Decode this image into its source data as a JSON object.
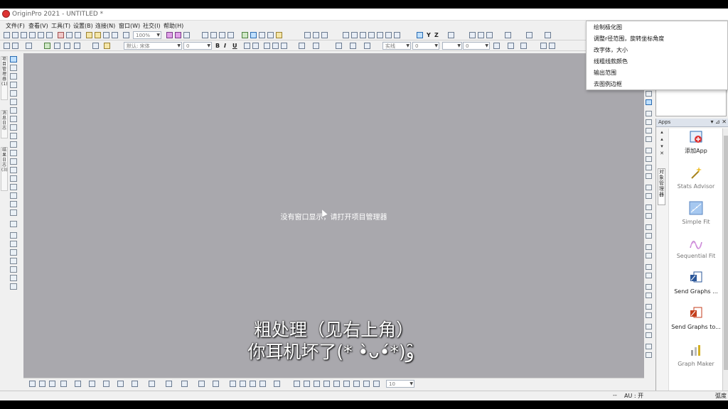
{
  "window": {
    "title": "OriginPro 2021 - UNTITLED *"
  },
  "menubar": {
    "items": [
      "文件(F)",
      "查看(V)",
      "工具(T)",
      "设置(B)",
      "连接(N)",
      "窗口(W)",
      "社交(I)",
      "帮助(H)"
    ]
  },
  "toolbar": {
    "zoom_value": "100%",
    "font_value": "默认: 宋体",
    "font_size_value": "0",
    "bold_label": "B",
    "italic_label": "I",
    "underline_label": "U",
    "line_style_label": "实线",
    "num_a": "0",
    "num_b": "0",
    "label_z": "Z",
    "label_y": "Y"
  },
  "left_toolbar": {
    "tabs": [
      "项目管理器 (1)",
      "消息日志",
      "结果日志 (3)"
    ]
  },
  "workspace": {
    "message": "没有窗口显示，请打开项目管理器"
  },
  "subtitles": {
    "line1": "粗处理（见右上角）",
    "line2": "你耳机坏了(* •̀ᴗ•́*)و ̑̑"
  },
  "bottom_toolbar": {
    "size_value": "10"
  },
  "statusbar": {
    "separator": "--",
    "au": "AU : 开",
    "angle": "弧度"
  },
  "context_menu": {
    "items": [
      "绘制极化图",
      "调整r径范围，旋转坐标角度",
      "改字体，大小",
      "线粗线款颜色",
      "输出范围",
      "去图例边框"
    ]
  },
  "apps_panel": {
    "title": "Apps",
    "side_tab": "对象管理器",
    "items": [
      {
        "name": "添加App",
        "icon": "add-app-icon"
      },
      {
        "name": "Stats Advisor",
        "icon": "wand-icon"
      },
      {
        "name": "Simple Fit",
        "icon": "simple-fit-icon"
      },
      {
        "name": "Sequential Fit",
        "icon": "sequential-fit-icon"
      },
      {
        "name": "Send Graphs ...",
        "icon": "word-icon"
      },
      {
        "name": "Send Graphs to...",
        "icon": "powerpoint-icon"
      },
      {
        "name": "Graph Maker",
        "icon": "graph-maker-icon"
      }
    ]
  },
  "colors": {
    "workspace_bg": "#a9a8ad",
    "accent": "#2a6ab0",
    "subtitle": "#ffffff"
  }
}
